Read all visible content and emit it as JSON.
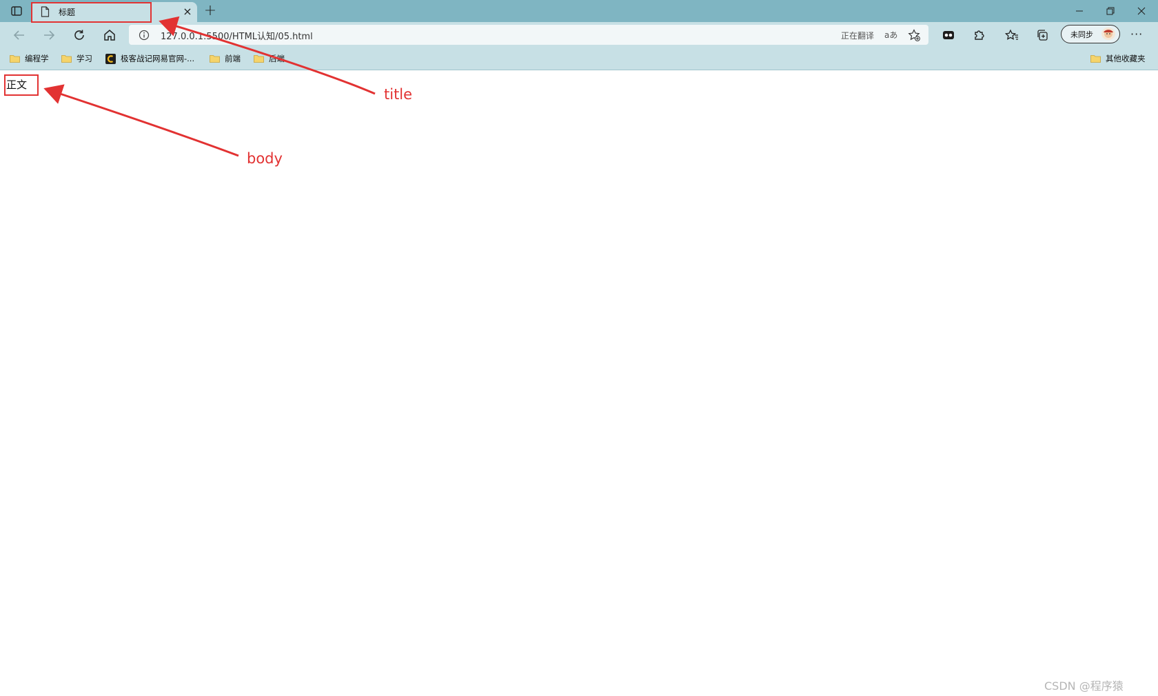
{
  "browser": {
    "tab": {
      "title": "标题",
      "close_glyph": "×"
    },
    "new_tab_glyph": "+",
    "address": {
      "url": "127.0.0.1:5500/HTML认知/05.html",
      "translate_status": "正在翻译",
      "translate_icon_text": "aあ"
    },
    "profile": {
      "sync_label": "未同步"
    },
    "more_glyph": "···",
    "bookmarks": [
      {
        "label": "编程学",
        "icon": "folder-icon"
      },
      {
        "label": "学习",
        "icon": "folder-icon"
      },
      {
        "label": "极客战记网易官网-...",
        "icon": "codecombat-logo-icon"
      },
      {
        "label": "前端",
        "icon": "folder-icon"
      },
      {
        "label": "后端",
        "icon": "folder-icon"
      }
    ],
    "other_bookmarks": "其他收藏夹"
  },
  "page": {
    "body_text": "正文"
  },
  "annotations": {
    "title_label": "title",
    "body_label": "body",
    "color": "#e23232"
  },
  "watermark": "CSDN @程序猿"
}
